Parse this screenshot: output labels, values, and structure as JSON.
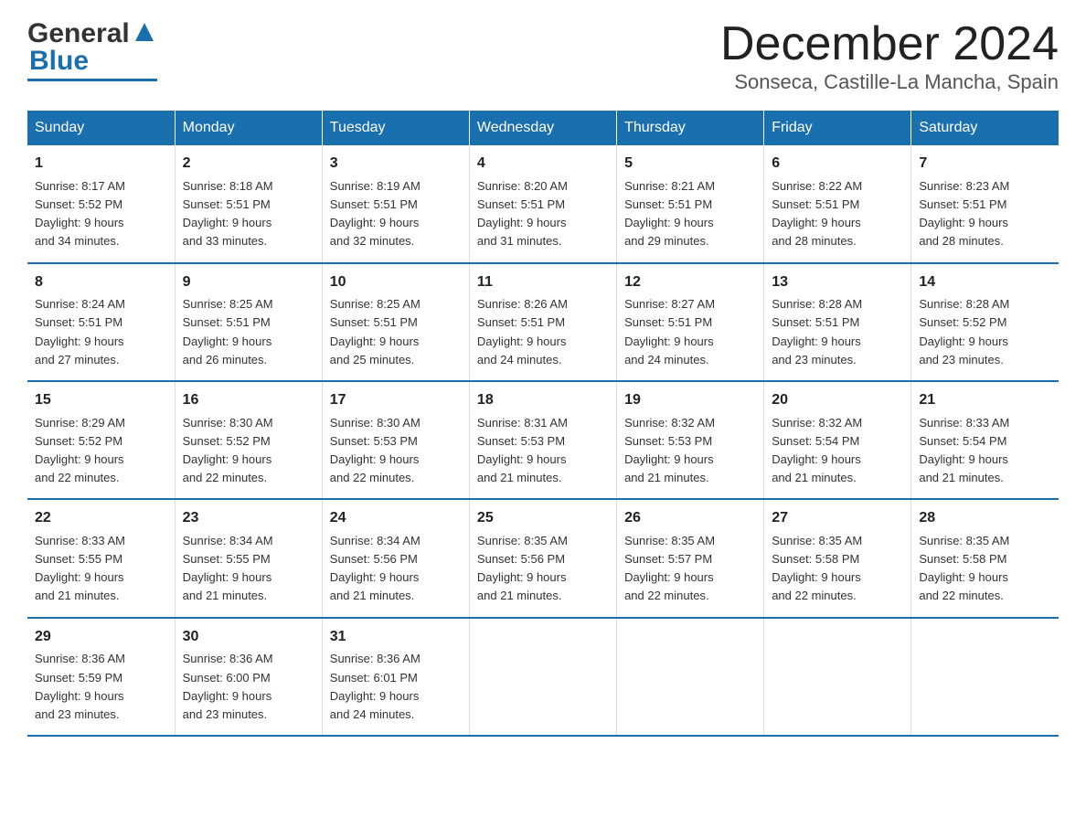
{
  "header": {
    "logo_general": "General",
    "logo_blue": "Blue",
    "month_title": "December 2024",
    "location": "Sonseca, Castille-La Mancha, Spain"
  },
  "weekdays": [
    "Sunday",
    "Monday",
    "Tuesday",
    "Wednesday",
    "Thursday",
    "Friday",
    "Saturday"
  ],
  "weeks": [
    [
      {
        "day": "1",
        "sunrise": "8:17 AM",
        "sunset": "5:52 PM",
        "daylight": "9 hours and 34 minutes."
      },
      {
        "day": "2",
        "sunrise": "8:18 AM",
        "sunset": "5:51 PM",
        "daylight": "9 hours and 33 minutes."
      },
      {
        "day": "3",
        "sunrise": "8:19 AM",
        "sunset": "5:51 PM",
        "daylight": "9 hours and 32 minutes."
      },
      {
        "day": "4",
        "sunrise": "8:20 AM",
        "sunset": "5:51 PM",
        "daylight": "9 hours and 31 minutes."
      },
      {
        "day": "5",
        "sunrise": "8:21 AM",
        "sunset": "5:51 PM",
        "daylight": "9 hours and 29 minutes."
      },
      {
        "day": "6",
        "sunrise": "8:22 AM",
        "sunset": "5:51 PM",
        "daylight": "9 hours and 28 minutes."
      },
      {
        "day": "7",
        "sunrise": "8:23 AM",
        "sunset": "5:51 PM",
        "daylight": "9 hours and 28 minutes."
      }
    ],
    [
      {
        "day": "8",
        "sunrise": "8:24 AM",
        "sunset": "5:51 PM",
        "daylight": "9 hours and 27 minutes."
      },
      {
        "day": "9",
        "sunrise": "8:25 AM",
        "sunset": "5:51 PM",
        "daylight": "9 hours and 26 minutes."
      },
      {
        "day": "10",
        "sunrise": "8:25 AM",
        "sunset": "5:51 PM",
        "daylight": "9 hours and 25 minutes."
      },
      {
        "day": "11",
        "sunrise": "8:26 AM",
        "sunset": "5:51 PM",
        "daylight": "9 hours and 24 minutes."
      },
      {
        "day": "12",
        "sunrise": "8:27 AM",
        "sunset": "5:51 PM",
        "daylight": "9 hours and 24 minutes."
      },
      {
        "day": "13",
        "sunrise": "8:28 AM",
        "sunset": "5:51 PM",
        "daylight": "9 hours and 23 minutes."
      },
      {
        "day": "14",
        "sunrise": "8:28 AM",
        "sunset": "5:52 PM",
        "daylight": "9 hours and 23 minutes."
      }
    ],
    [
      {
        "day": "15",
        "sunrise": "8:29 AM",
        "sunset": "5:52 PM",
        "daylight": "9 hours and 22 minutes."
      },
      {
        "day": "16",
        "sunrise": "8:30 AM",
        "sunset": "5:52 PM",
        "daylight": "9 hours and 22 minutes."
      },
      {
        "day": "17",
        "sunrise": "8:30 AM",
        "sunset": "5:53 PM",
        "daylight": "9 hours and 22 minutes."
      },
      {
        "day": "18",
        "sunrise": "8:31 AM",
        "sunset": "5:53 PM",
        "daylight": "9 hours and 21 minutes."
      },
      {
        "day": "19",
        "sunrise": "8:32 AM",
        "sunset": "5:53 PM",
        "daylight": "9 hours and 21 minutes."
      },
      {
        "day": "20",
        "sunrise": "8:32 AM",
        "sunset": "5:54 PM",
        "daylight": "9 hours and 21 minutes."
      },
      {
        "day": "21",
        "sunrise": "8:33 AM",
        "sunset": "5:54 PM",
        "daylight": "9 hours and 21 minutes."
      }
    ],
    [
      {
        "day": "22",
        "sunrise": "8:33 AM",
        "sunset": "5:55 PM",
        "daylight": "9 hours and 21 minutes."
      },
      {
        "day": "23",
        "sunrise": "8:34 AM",
        "sunset": "5:55 PM",
        "daylight": "9 hours and 21 minutes."
      },
      {
        "day": "24",
        "sunrise": "8:34 AM",
        "sunset": "5:56 PM",
        "daylight": "9 hours and 21 minutes."
      },
      {
        "day": "25",
        "sunrise": "8:35 AM",
        "sunset": "5:56 PM",
        "daylight": "9 hours and 21 minutes."
      },
      {
        "day": "26",
        "sunrise": "8:35 AM",
        "sunset": "5:57 PM",
        "daylight": "9 hours and 22 minutes."
      },
      {
        "day": "27",
        "sunrise": "8:35 AM",
        "sunset": "5:58 PM",
        "daylight": "9 hours and 22 minutes."
      },
      {
        "day": "28",
        "sunrise": "8:35 AM",
        "sunset": "5:58 PM",
        "daylight": "9 hours and 22 minutes."
      }
    ],
    [
      {
        "day": "29",
        "sunrise": "8:36 AM",
        "sunset": "5:59 PM",
        "daylight": "9 hours and 23 minutes."
      },
      {
        "day": "30",
        "sunrise": "8:36 AM",
        "sunset": "6:00 PM",
        "daylight": "9 hours and 23 minutes."
      },
      {
        "day": "31",
        "sunrise": "8:36 AM",
        "sunset": "6:01 PM",
        "daylight": "9 hours and 24 minutes."
      },
      null,
      null,
      null,
      null
    ]
  ],
  "labels": {
    "sunrise": "Sunrise:",
    "sunset": "Sunset:",
    "daylight": "Daylight:"
  }
}
